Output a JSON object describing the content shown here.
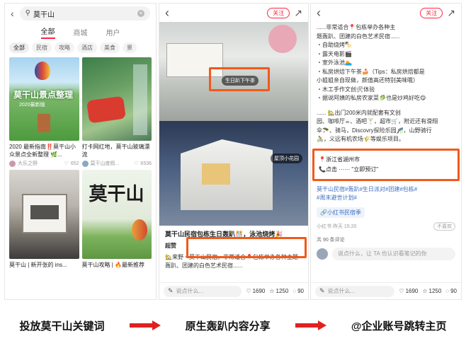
{
  "panel1": {
    "search_query": "莫干山",
    "tabs": [
      "全部",
      "商城",
      "用户"
    ],
    "chips": [
      "全部",
      "民宿",
      "攻略",
      "酒店",
      "美食",
      "景"
    ],
    "cards": [
      {
        "title": "2020 最新指南‼️莫干山小众景点全新整理 🌿...",
        "author": "大乐之野",
        "likes": "652",
        "overlay": "莫干山景点整理",
        "overlay2": "2020最新版"
      },
      {
        "title": "打卡网红地，莫干山玻璃漂流",
        "author": "莫干山度假...",
        "likes": "6536",
        "overlay": "",
        "overlay2": ""
      },
      {
        "title": "莫干山 | 新开张的 ins...",
        "author": "",
        "likes": "",
        "overlay": "",
        "overlay2": ""
      },
      {
        "title": "莫干山攻略 | 🔥最新推荐",
        "author": "",
        "likes": "",
        "overlay": "莫干山",
        "overlay2": ""
      }
    ]
  },
  "panel2": {
    "follow_label": "关注",
    "tag1": "生日趴下午茶",
    "tag2": "屋顶小花园",
    "title": "莫干山民宿包栋生日轰趴🎊，泳池烧烤🎉",
    "title_prefix": "莫干山",
    "title_highlight": "民宿包栋生日轰趴🎊，泳池烧烤🎉",
    "subtitle": "超赞",
    "body": "🏡来野・莫干山民宿。非常适合📍包栋举办各种主题轰趴、团建的白色艺术民宿......",
    "say_placeholder": "说点什么...",
    "likes": "1690",
    "stars": "1250",
    "comments": "90"
  },
  "panel3": {
    "follow_label": "关注",
    "lines_top": [
      "......非常适合📍包栋举办各种主",
      "题轰趴、团建的白色艺术民宿......",
      "・自助烧烤🍢",
      "・露天电影🎬",
      "・室外泳池🏊",
      "・私房烘焙下午茶🍰（Tips：私房烘焙都是",
      "小姐姐亲自现做，颜值高还特别美味哦）",
      "・木工手作文创🛠体验",
      "・据说阿姨的私房农家菜🥬也是炒鸡好吃😋"
    ],
    "lines_mid": [
      "...... 🏡出门200米内就配套有文创",
      "园、咖啡厅☕、酒吧🍸，超市🛒，附近还有滑翔",
      "伞🪂、骑马，Discovry探险乐园🎢，山野骑行",
      "🚴，义远有机农场🌾等娱乐项目。"
    ],
    "location": "📍浙江省湖州市",
    "contact_line": "📞点击 ······ \"立即预订\"",
    "hashtags": [
      "莫干山民宿#轰趴#生日派对#团建#包栋#",
      "#周末避世计划#"
    ],
    "link_tag": "🔗小红书民宿季",
    "meta_date": "小红书 昨天 15:20",
    "report_label": "不喜欢",
    "comment_count": "共 90 条评论",
    "comment_placeholder": "说点什么，让 TA 也认识看笔记的你",
    "say_placeholder": "说点什么...",
    "likes": "1690",
    "stars": "1250",
    "comments": "90"
  },
  "flow": {
    "step1": "投放莫干山关键词",
    "step2": "原生轰趴内容分享",
    "step3": "@企业账号跳转主页"
  },
  "colors": {
    "accent": "#ff2442",
    "highlight_box": "#f05a1a",
    "arrow": "#e0211f"
  }
}
